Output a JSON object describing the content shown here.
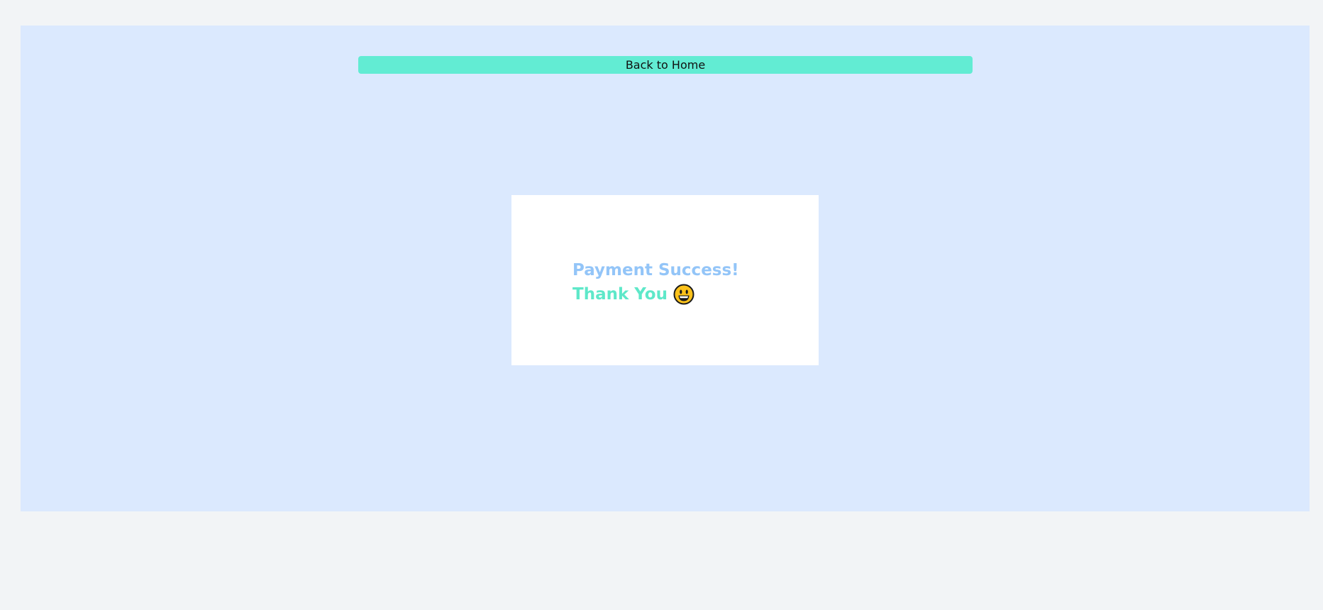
{
  "nav": {
    "back_label": "Back to Home"
  },
  "confirmation": {
    "headline": "Payment Success!",
    "subline": "Thank You",
    "icon": "grinning-face-icon"
  },
  "colors": {
    "page_background": "#f2f4f6",
    "panel_background": "#dbe9fe",
    "button_background": "#62ecd3",
    "card_background": "#ffffff",
    "headline_color": "#93c5f8",
    "subline_color": "#5ee8c9",
    "emoji_fill": "#fcc21b"
  }
}
